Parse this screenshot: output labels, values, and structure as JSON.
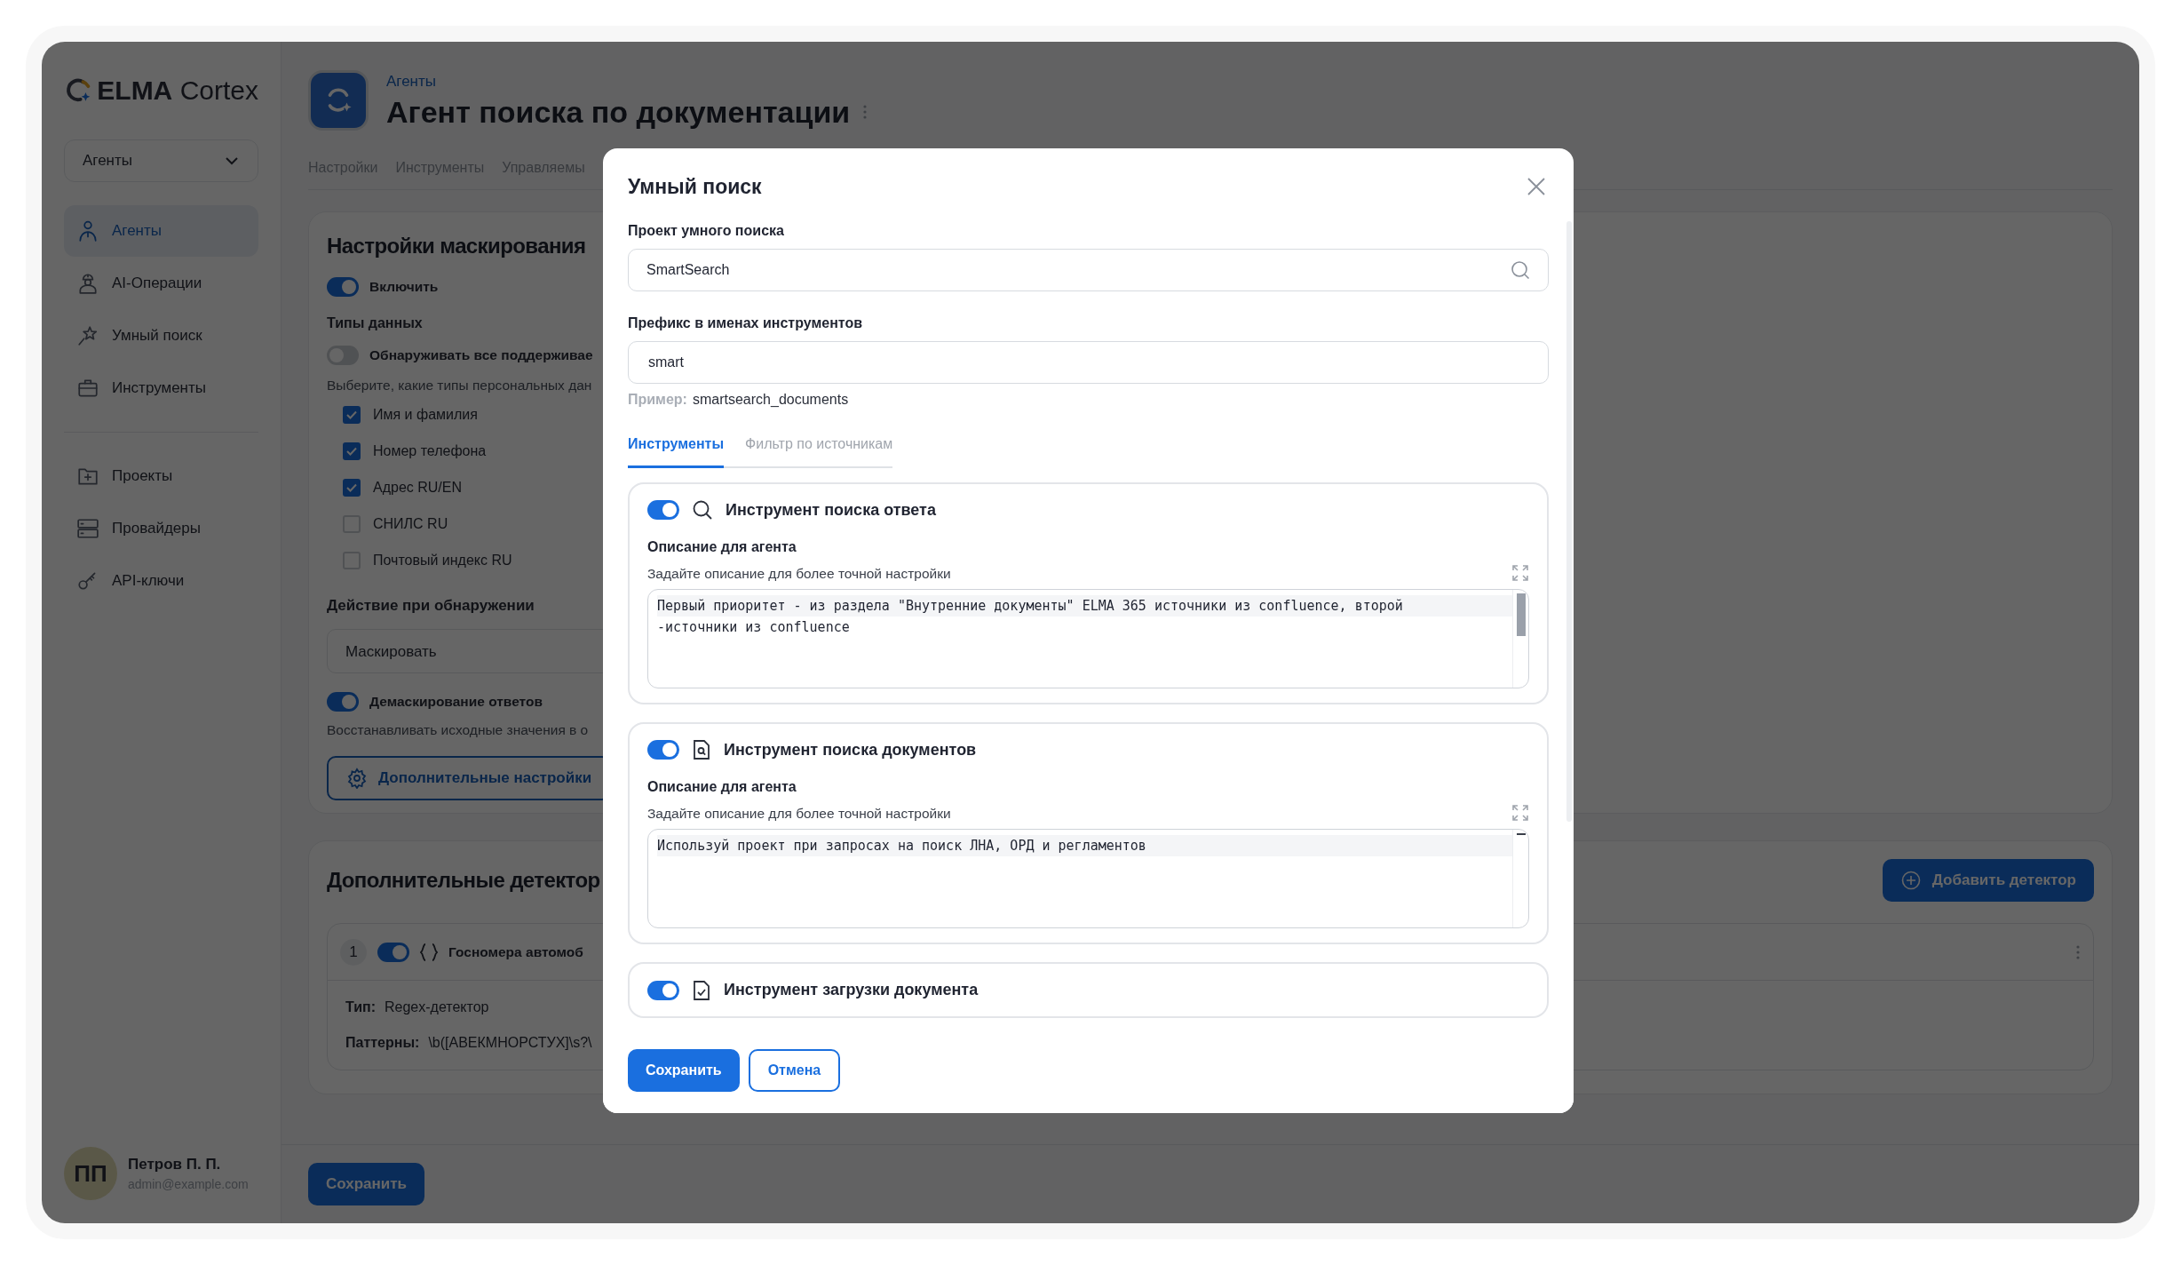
{
  "sidebar": {
    "logo": {
      "brand": "ELMA",
      "product": "Cortex"
    },
    "workspace_select": "Агенты",
    "nav_groups": [
      [
        {
          "label": "Агенты",
          "selected": true
        },
        {
          "label": "AI-Операции",
          "selected": false
        },
        {
          "label": "Умный поиск",
          "selected": false
        },
        {
          "label": "Инструменты",
          "selected": false
        }
      ],
      [
        {
          "label": "Проекты",
          "selected": false
        },
        {
          "label": "Провайдеры",
          "selected": false
        },
        {
          "label": "API-ключи",
          "selected": false
        }
      ]
    ],
    "user": {
      "initials": "ПП",
      "name": "Петров П. П.",
      "email": "admin@example.com"
    }
  },
  "page": {
    "breadcrumb": "Агенты",
    "title": "Агент поиска по документации",
    "tabs": [
      "Настройки",
      "Инструменты",
      "Управляемы"
    ],
    "masking": {
      "title": "Настройки маскирования",
      "enable": {
        "label": "Включить",
        "on": true
      },
      "data_types_label": "Типы данных",
      "detect_all": {
        "label": "Обнаруживать все поддерживае",
        "on": false
      },
      "hint": "Выберите, какие типы персональных дан",
      "checkboxes": [
        {
          "label": "Имя и фамилия",
          "checked": true
        },
        {
          "label": "Номер телефона",
          "checked": true
        },
        {
          "label": "Адрес RU/EN",
          "checked": true
        },
        {
          "label": "СНИЛС RU",
          "checked": false
        },
        {
          "label": "Почтовый индекс RU",
          "checked": false
        }
      ],
      "action_label": "Действие при обнаружении",
      "action_select": "Маскировать",
      "unmask": {
        "label": "Демаскирование ответов",
        "on": true
      },
      "unmask_hint": "Восстанавливать исходные значения в о",
      "advanced_button": "Дополнительные настройки"
    },
    "detectors": {
      "title": "Дополнительные детектор",
      "add_button": "Добавить детектор",
      "items": [
        {
          "number": "1",
          "on": true,
          "name": "Госномера автомоб",
          "type_label": "Тип:",
          "type": "Regex-детектор",
          "patterns_label": "Паттерны:",
          "patterns": "\\b([АВЕКМНОРСТУХ]\\s?\\"
        }
      ]
    },
    "save_button": "Сохранить"
  },
  "dialog": {
    "title": "Умный поиск",
    "project": {
      "label": "Проект умного поиска",
      "value": "SmartSearch"
    },
    "prefix": {
      "label": "Префикс в именах инструментов",
      "value": "smart",
      "example_label": "Пример:",
      "example_value": "smartsearch_documents"
    },
    "tabs": [
      {
        "label": "Инструменты",
        "selected": true
      },
      {
        "label": "Фильтр по источникам",
        "selected": false
      }
    ],
    "tools": [
      {
        "title": "Инструмент поиска ответа",
        "on": true,
        "description_label": "Описание для агента",
        "description_hint": "Задайте описание для более точной настройки",
        "lines": [
          "Первый приоритет - из раздела \"Внутренние документы\" ELMA 365 источники из confluence, второй",
          "-источники из confluence"
        ]
      },
      {
        "title": "Инструмент поиска документов",
        "on": true,
        "description_label": "Описание для агента",
        "description_hint": "Задайте описание для более точной настройки",
        "lines": [
          "Используй проект при запросах на поиск ЛНА, ОРД и регламентов"
        ]
      },
      {
        "title": "Инструмент загрузки документа",
        "on": true
      }
    ],
    "save_button": "Сохранить",
    "cancel_button": "Отмена"
  }
}
